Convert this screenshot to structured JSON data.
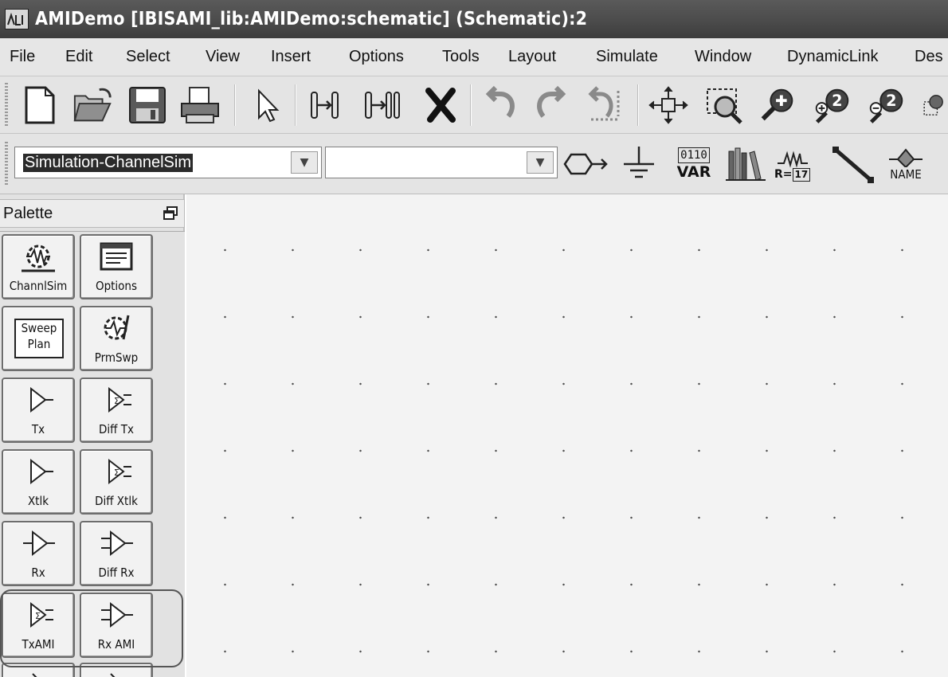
{
  "window": {
    "title": "AMIDemo [IBISAMI_lib:AMIDemo:schematic] (Schematic):2"
  },
  "menu": {
    "items": [
      "File",
      "Edit",
      "Select",
      "View",
      "Insert",
      "Options",
      "Tools",
      "Layout",
      "Simulate",
      "Window",
      "DynamicLink",
      "Des"
    ]
  },
  "toolbar": {
    "icons": [
      "new-document-icon",
      "open-folder-icon",
      "save-icon",
      "print-icon",
      "select-pointer-icon",
      "insert-pin-icon",
      "insert-port-icon",
      "delete-icon",
      "undo-icon",
      "redo-icon",
      "undo-history-icon",
      "move-icon",
      "zoom-area-icon",
      "zoom-in-icon",
      "zoom-in-2x-icon",
      "zoom-out-2x-icon",
      "zoom-fit-icon"
    ]
  },
  "component_bar": {
    "library_value": "Simulation-ChannelSim",
    "component_value": "",
    "var_label": "VAR",
    "var_bits": "0110",
    "resistor_label": "R=",
    "resistor_value": "17",
    "name_label": "NAME"
  },
  "palette": {
    "title": "Palette",
    "items": [
      {
        "label": "ChannlSim",
        "icon": "channel-sim-icon"
      },
      {
        "label": "Options",
        "icon": "options-icon"
      },
      {
        "label": "Plan",
        "icon": "sweep-plan-icon",
        "icon_text": "Sweep"
      },
      {
        "label": "PrmSwp",
        "icon": "param-sweep-icon"
      },
      {
        "label": "Tx",
        "icon": "tx-icon"
      },
      {
        "label": "Diff Tx",
        "icon": "diff-tx-icon"
      },
      {
        "label": "Xtlk",
        "icon": "xtlk-icon"
      },
      {
        "label": "Diff Xtlk",
        "icon": "diff-xtlk-icon"
      },
      {
        "label": "Rx",
        "icon": "rx-icon"
      },
      {
        "label": "Diff Rx",
        "icon": "diff-rx-icon"
      },
      {
        "label": "TxAMI",
        "icon": "tx-ami-icon"
      },
      {
        "label": "Rx AMI",
        "icon": "rx-ami-icon"
      }
    ]
  },
  "colors": {
    "titlebar": "#4a4a4a",
    "toolbar": "#e4e4e4",
    "canvas": "#f3f3f3",
    "selection": "#2b2b2b"
  }
}
